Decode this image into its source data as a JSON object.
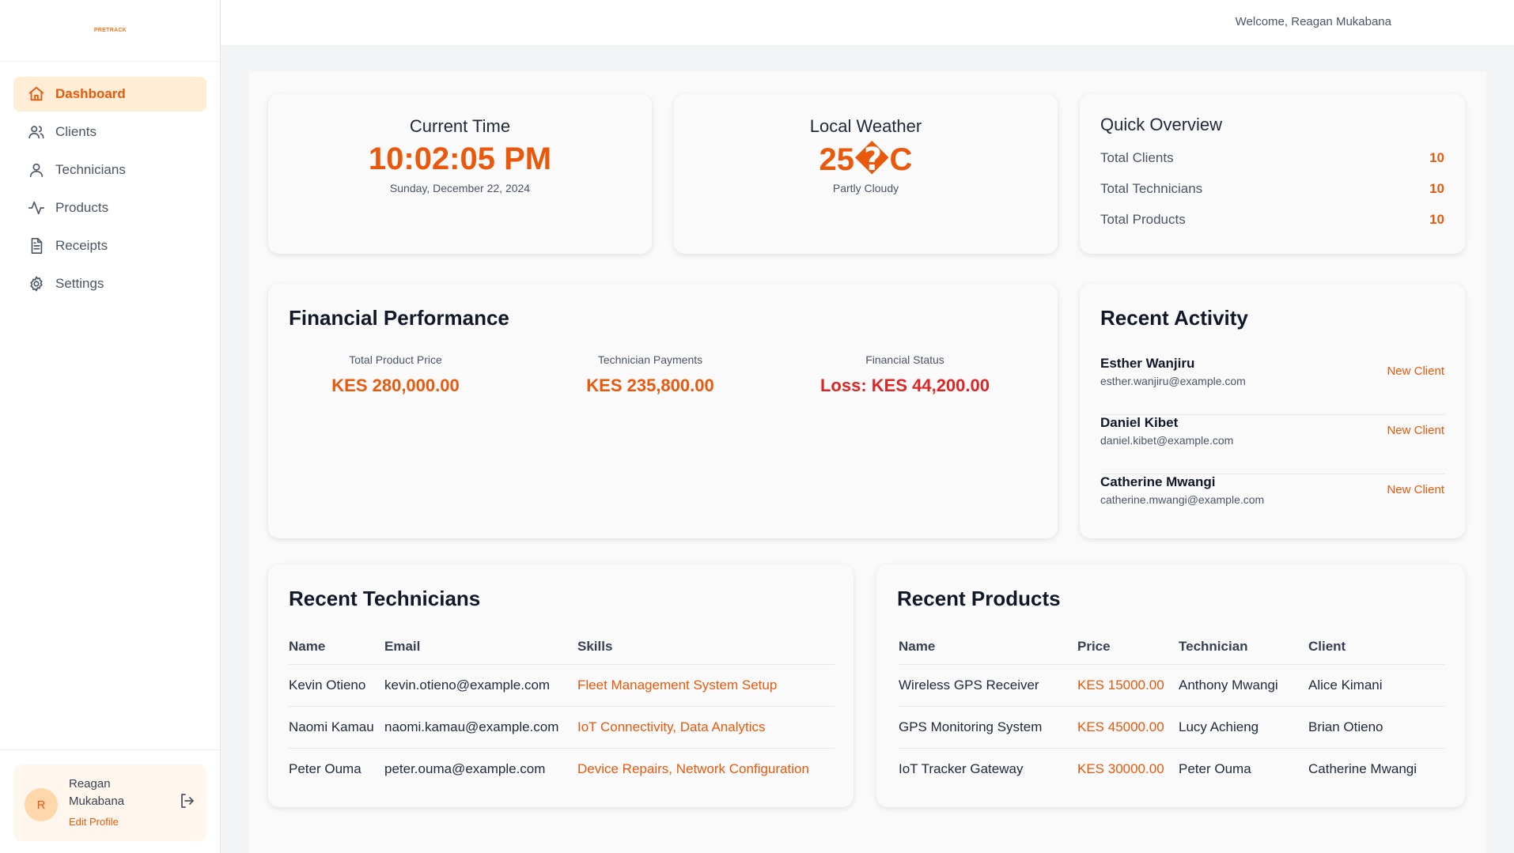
{
  "app": {
    "logo_text": "PRETRACK"
  },
  "sidebar": {
    "items": [
      {
        "label": "Dashboard"
      },
      {
        "label": "Clients"
      },
      {
        "label": "Technicians"
      },
      {
        "label": "Products"
      },
      {
        "label": "Receipts"
      },
      {
        "label": "Settings"
      }
    ],
    "user": {
      "initial": "R",
      "name": "Reagan Mukabana",
      "edit_label": "Edit Profile"
    }
  },
  "header": {
    "welcome": "Welcome, Reagan Mukabana"
  },
  "time_card": {
    "title": "Current Time",
    "time": "10:02:05 PM",
    "date": "Sunday, December 22, 2024"
  },
  "weather_card": {
    "title": "Local Weather",
    "temp": "25�C",
    "condition": "Partly Cloudy"
  },
  "overview": {
    "title": "Quick Overview",
    "rows": [
      {
        "label": "Total Clients",
        "value": "10"
      },
      {
        "label": "Total Technicians",
        "value": "10"
      },
      {
        "label": "Total Products",
        "value": "10"
      }
    ]
  },
  "financial": {
    "title": "Financial Performance",
    "cols": [
      {
        "label": "Total Product Price",
        "value": "KES 280,000.00"
      },
      {
        "label": "Technician Payments",
        "value": "KES 235,800.00"
      },
      {
        "label": "Financial Status",
        "value": "Loss: KES 44,200.00"
      }
    ]
  },
  "activity": {
    "title": "Recent Activity",
    "items": [
      {
        "name": "Esther Wanjiru",
        "email": "esther.wanjiru@example.com",
        "tag": "New Client"
      },
      {
        "name": "Daniel Kibet",
        "email": "daniel.kibet@example.com",
        "tag": "New Client"
      },
      {
        "name": "Catherine Mwangi",
        "email": "catherine.mwangi@example.com",
        "tag": "New Client"
      }
    ]
  },
  "technicians": {
    "title": "Recent Technicians",
    "headers": [
      "Name",
      "Email",
      "Skills"
    ],
    "rows": [
      [
        "Kevin Otieno",
        "kevin.otieno@example.com",
        "Fleet Management System Setup"
      ],
      [
        "Naomi Kamau",
        "naomi.kamau@example.com",
        "IoT Connectivity, Data Analytics"
      ],
      [
        "Peter Ouma",
        "peter.ouma@example.com",
        "Device Repairs, Network Configuration"
      ]
    ]
  },
  "products": {
    "title": "Recent Products",
    "headers": [
      "Name",
      "Price",
      "Technician",
      "Client"
    ],
    "rows": [
      [
        "Wireless GPS Receiver",
        "KES 15000.00",
        "Anthony Mwangi",
        "Alice Kimani"
      ],
      [
        "GPS Monitoring System",
        "KES 45000.00",
        "Lucy Achieng",
        "Brian Otieno"
      ],
      [
        "IoT Tracker Gateway",
        "KES 30000.00",
        "Peter Ouma",
        "Catherine Mwangi"
      ]
    ]
  },
  "colors": {
    "accent": "#ea580c",
    "accent_light": "#ffedd5",
    "loss": "#dc2626"
  }
}
